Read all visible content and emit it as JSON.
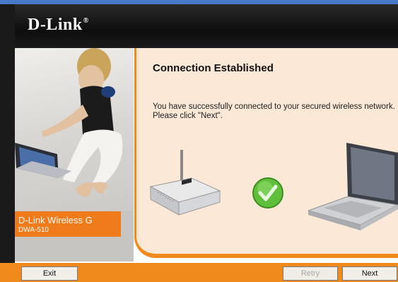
{
  "header": {
    "logo_text": "D-Link",
    "logo_mark": "®"
  },
  "product": {
    "name": "D-Link Wireless G",
    "model": "DWA-510"
  },
  "main": {
    "heading": "Connection Established",
    "message_line1": "You have successfully connected to your secured wireless network.",
    "message_line2": "Please click \"Next\"."
  },
  "buttons": {
    "exit": "Exit",
    "retry": "Retry",
    "next": "Next"
  },
  "colors": {
    "accent": "#f08a1c",
    "header": "#111111",
    "panel": "#fbe8d6"
  },
  "icons": [
    "router-icon",
    "checkmark-icon",
    "laptop-icon"
  ]
}
